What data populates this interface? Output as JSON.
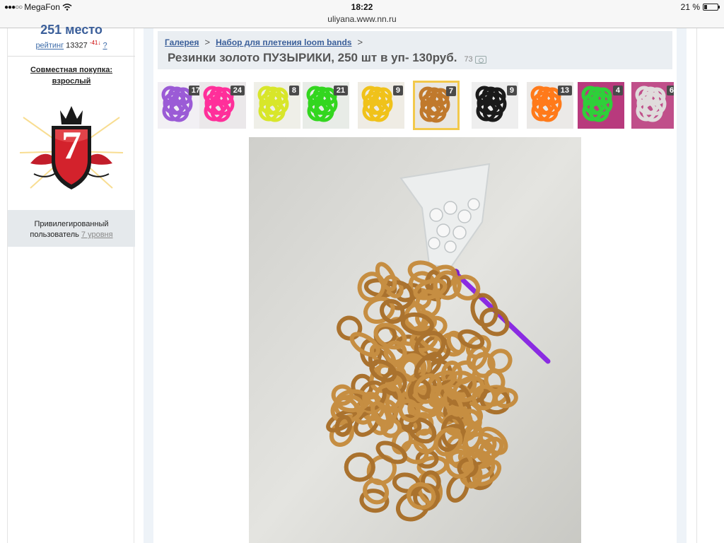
{
  "status_bar": {
    "carrier": "MegaFon",
    "time": "18:22",
    "battery": "21 %",
    "battery_level": 0.21
  },
  "browser": {
    "url": "uliyana.www.nn.ru"
  },
  "sidebar": {
    "place": "251 место",
    "rating_label": "рейтинг",
    "rating_value": "13327",
    "rating_delta": "-41",
    "rating_help": "?",
    "joint_line1": "Совместная покупка:",
    "joint_line2": "взрослый",
    "badge_number": "7",
    "status_line1": "Привилегированный",
    "status_line2": "пользователь",
    "status_level": "7 уровня"
  },
  "header": {
    "breadcrumbs": [
      "Галерея",
      "Набор для плетения loom bands"
    ],
    "separator": ">",
    "title": "Резинки золото ПУЗЫРИКИ, 250 шт в уп- 130руб.",
    "photo_count": "73"
  },
  "thumbnails": [
    {
      "count": "17",
      "color": "#9b5bd6",
      "bg": "#f2f0f4"
    },
    {
      "count": "24",
      "color": "#ff2f9a",
      "bg": "#ebe8ea"
    },
    {
      "count": "8",
      "color": "#d8e62a",
      "bg": "#efefe8"
    },
    {
      "count": "21",
      "color": "#33d61f",
      "bg": "#e8ece7"
    },
    {
      "count": "9",
      "color": "#f0c21a",
      "bg": "#efece4"
    },
    {
      "count": "7",
      "color": "#c0792c",
      "bg": "#e9e7e3",
      "active": true
    },
    {
      "count": "9",
      "color": "#1a1a1a",
      "bg": "#eeeeee"
    },
    {
      "count": "13",
      "color": "#ff7a1a",
      "bg": "#ebe9e7"
    },
    {
      "count": "4",
      "color": "#2fcf3a",
      "bg": "#b83a7d"
    },
    {
      "count": "6",
      "color": "#e0dcdc",
      "bg": "#c04f8a"
    }
  ],
  "colors": {
    "accent": "#3b5f9a",
    "band_gold": "#c58a3a",
    "hook_purple": "#8a2be2"
  },
  "icons": {
    "camera": "camera-icon",
    "wifi": "wifi-icon",
    "battery": "battery-icon"
  }
}
